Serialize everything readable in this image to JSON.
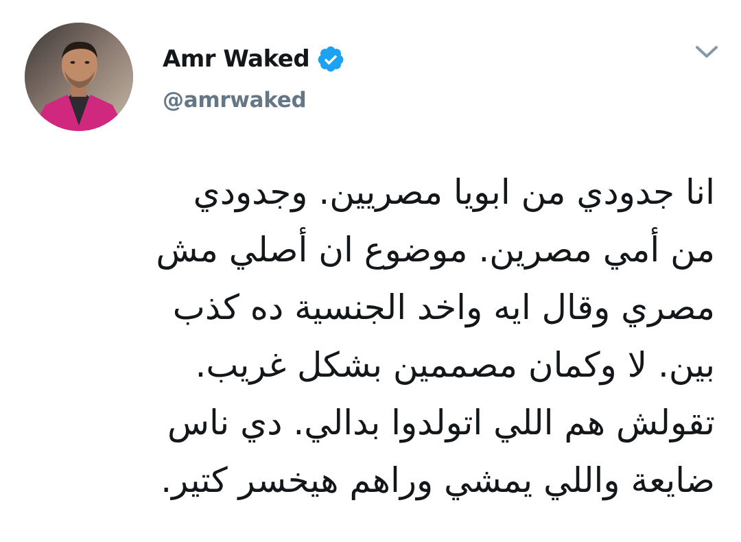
{
  "tweet": {
    "author": {
      "display_name": "Amr Waked",
      "handle": "@amrwaked",
      "verified": true,
      "avatar_icon": "profile-photo"
    },
    "menu_icon": "chevron-down-icon",
    "text_lines": [
      "انا جدودي من ابويا مصريين. وجدودي",
      "من أمي مصرين. موضوع ان أصلي مش",
      "مصري وقال ايه واخد الجنسية ده كذب",
      "بين. لا وكمان مصممين بشكل غريب.",
      "تقولش هم اللي اتولدوا بدالي. دي ناس",
      "ضايعة واللي يمشي وراهم هيخسر كتير."
    ]
  },
  "colors": {
    "text_primary": "#14171a",
    "text_secondary": "#657786",
    "verified_blue": "#1da1f2",
    "background": "#ffffff"
  }
}
